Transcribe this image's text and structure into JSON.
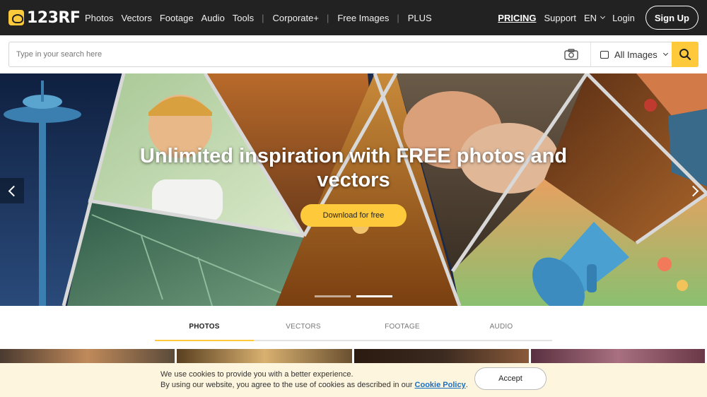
{
  "header": {
    "logo_text": "123RF",
    "nav": [
      "Photos",
      "Vectors",
      "Footage",
      "Audio",
      "Tools",
      "Corporate+",
      "Free Images",
      "PLUS"
    ],
    "pricing": "PRICING",
    "support": "Support",
    "language": "EN",
    "login": "Login",
    "signup": "Sign Up"
  },
  "search": {
    "placeholder": "Type in your search here",
    "value": "",
    "category": "All Images"
  },
  "hero": {
    "title": "Unlimited inspiration with FREE photos and vectors",
    "cta": "Download for free",
    "slide_count": 2,
    "active_slide": 2
  },
  "tabs": [
    {
      "label": "PHOTOS",
      "active": true
    },
    {
      "label": "VECTORS",
      "active": false
    },
    {
      "label": "FOOTAGE",
      "active": false
    },
    {
      "label": "AUDIO",
      "active": false
    }
  ],
  "cookie": {
    "line1": "We use cookies to provide you with a better experience.",
    "line2_prefix": "By using our website, you agree to the use of cookies as described in our ",
    "link": "Cookie Policy",
    "line2_suffix": ".",
    "accept": "Accept"
  },
  "colors": {
    "brand": "#ffc93c",
    "nav_bg": "#222222",
    "cookie_bg": "#fdf5dd",
    "link": "#1a6fc4"
  }
}
